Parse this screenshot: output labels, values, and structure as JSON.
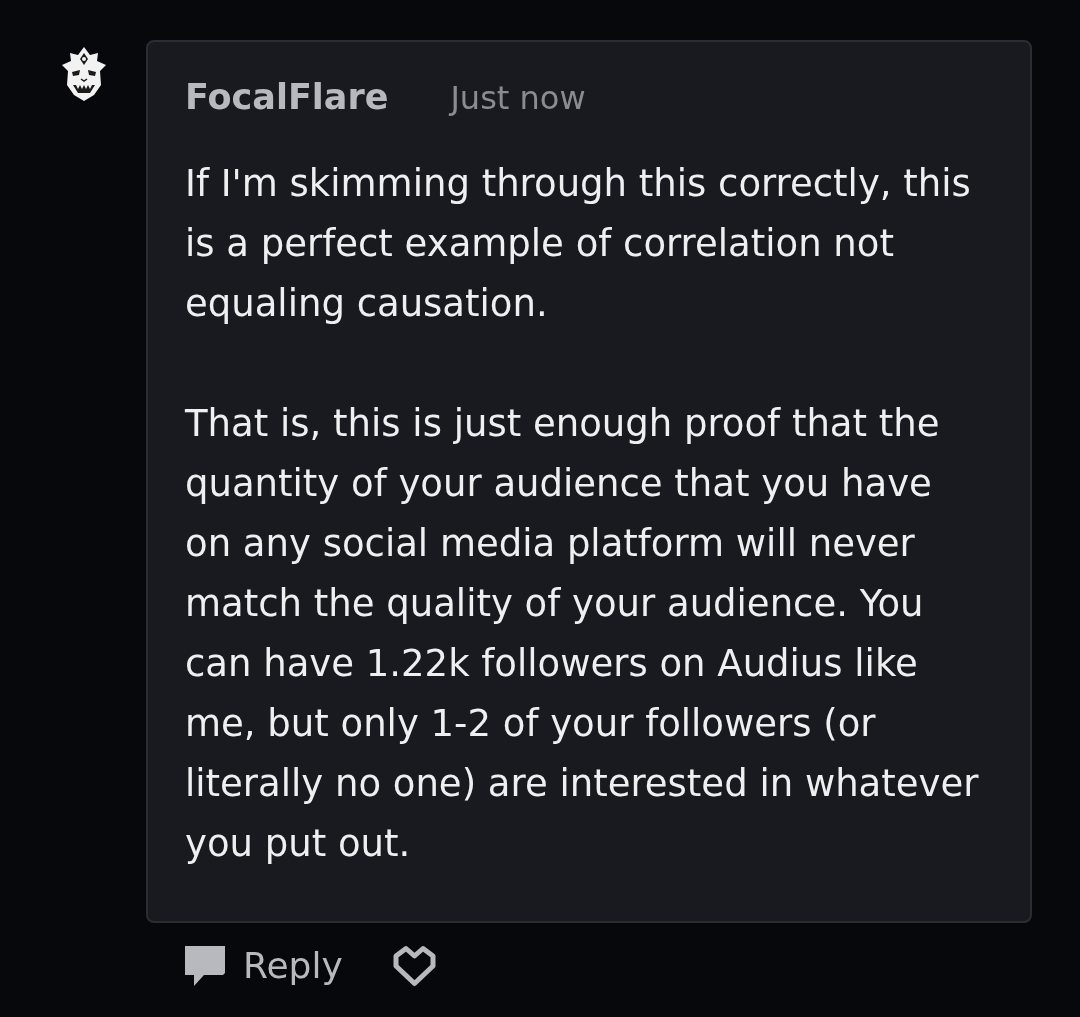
{
  "comment": {
    "author": "FocalFlare",
    "time": "Just now",
    "paragraphs": [
      "If I'm skimming through this correctly, this is a perfect example of correlation not equaling causation.",
      "That is, this is just enough proof that the quantity of your audience that you have on any social media platform will never match the quality of your audience. You can have 1.22k followers on Audius like me, but only 1-2 of your followers (or literally no one) are interested in whatever you put out."
    ]
  },
  "actions": {
    "reply": {
      "label": "Reply"
    },
    "like": {
      "liked": false
    }
  }
}
